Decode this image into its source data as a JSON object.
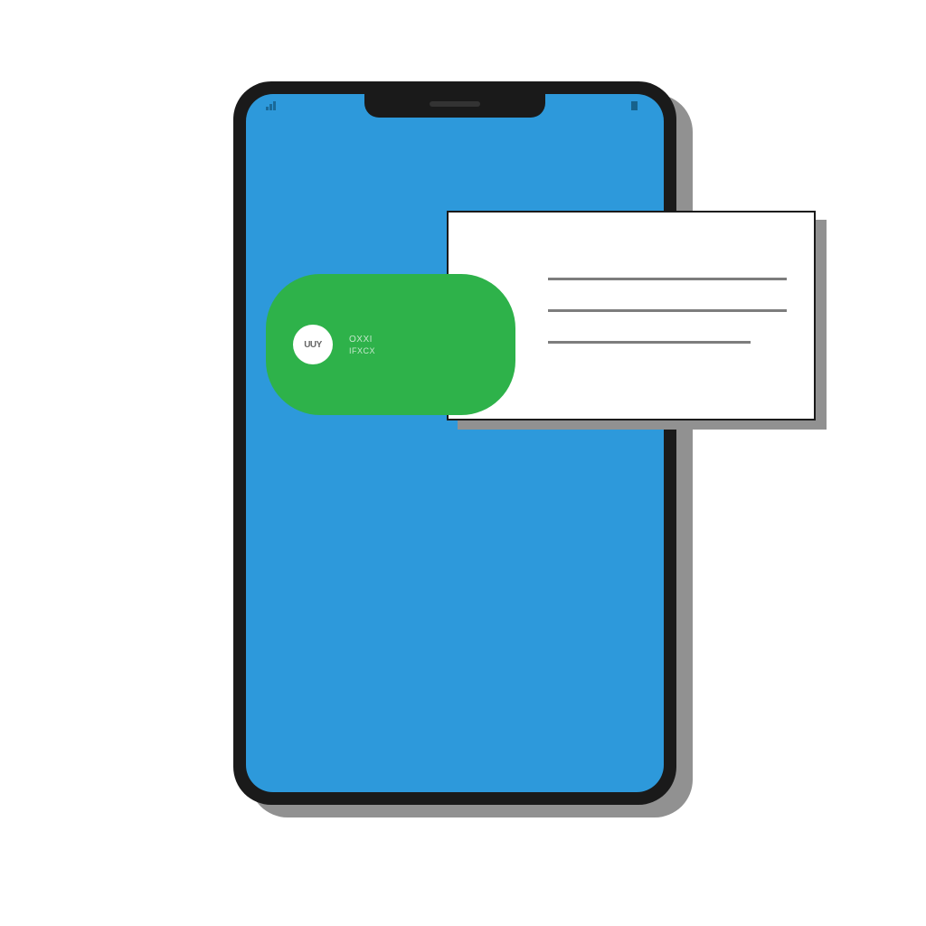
{
  "colors": {
    "screen": "#2d99db",
    "pill": "#2eb24a",
    "frame": "#1a1a1a",
    "shadow": "#919191"
  },
  "pill": {
    "circle_label": "UUY",
    "line1": "OXXI",
    "line2": "IFXCX"
  }
}
